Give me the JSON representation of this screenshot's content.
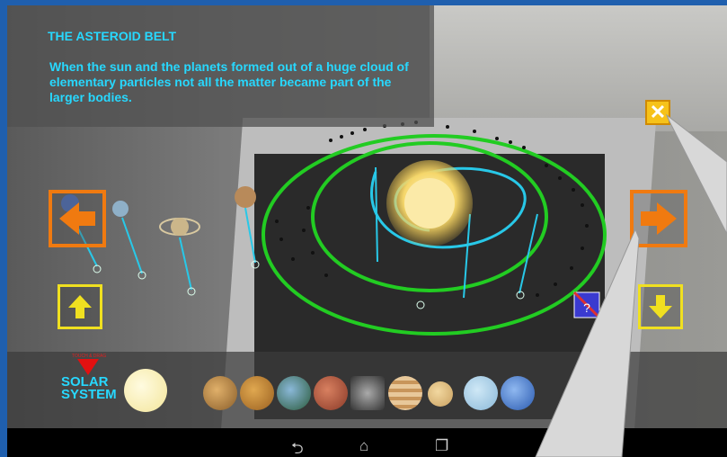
{
  "info": {
    "title": "THE ASTEROID BELT",
    "description": "When the sun and the planets formed out of a huge cloud of elementary particles not all the matter became part of the larger bodies."
  },
  "controls": {
    "close_icon": "close-icon",
    "prev_icon": "arrow-left-icon",
    "next_icon": "arrow-right-icon",
    "up_icon": "arrow-up-icon",
    "down_icon": "arrow-down-icon"
  },
  "bottom_bar": {
    "solar_label_line1": "SOLAR",
    "solar_label_line2": "SYSTEM",
    "tip_text": "TOUCH & DRAG",
    "planets": [
      "sun",
      "mercury",
      "venus",
      "earth",
      "mars",
      "asteroid-belt",
      "jupiter",
      "saturn",
      "uranus",
      "neptune"
    ]
  },
  "system_nav": {
    "back": "⮌",
    "home": "⌂",
    "recent": "❐"
  },
  "colors": {
    "accent_cyan": "#27d8ff",
    "orbit_green": "#22cc22",
    "nav_orange": "#f07a10",
    "nav_yellow": "#f0e020"
  }
}
